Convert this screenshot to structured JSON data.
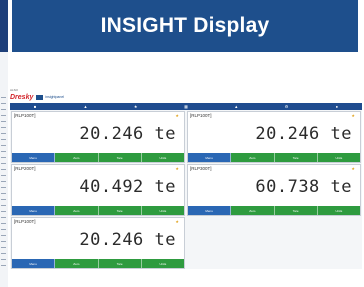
{
  "banner": {
    "title": "INSIGHT Display"
  },
  "app": {
    "brand": {
      "small": "ALSO",
      "name": "Dresky",
      "sub": "insightpanel"
    },
    "toolbar_icons": [
      "menu-icon",
      "home-icon",
      "star-icon",
      "grid-icon",
      "chart-icon",
      "settings-icon",
      "info-icon"
    ]
  },
  "panels": [
    {
      "tag": "[RLP100T]",
      "value": "20.246 te",
      "buttons": [
        "Menu",
        "Zero",
        "Tare",
        "Units"
      ]
    },
    {
      "tag": "[RLP100T]",
      "value": "20.246 te",
      "buttons": [
        "Menu",
        "Zero",
        "Tare",
        "Units"
      ]
    },
    {
      "tag": "[RLP200T]",
      "value": "40.492 te",
      "buttons": [
        "Menu",
        "Zero",
        "Tare",
        "Units"
      ]
    },
    {
      "tag": "[RLP300T]",
      "value": "60.738 te",
      "buttons": [
        "Menu",
        "Zero",
        "Tare",
        "Units"
      ]
    },
    {
      "tag": "[RLP100T]",
      "value": "20.246 te",
      "buttons": [
        "Menu",
        "Zero",
        "Tare",
        "Units"
      ]
    }
  ],
  "colors": {
    "banner": "#1e4f8c",
    "toolbar": "#1f4c8f",
    "button_blue": "#2a67b4",
    "button_green": "#2e9b3f",
    "brand_red": "#d2242a"
  }
}
